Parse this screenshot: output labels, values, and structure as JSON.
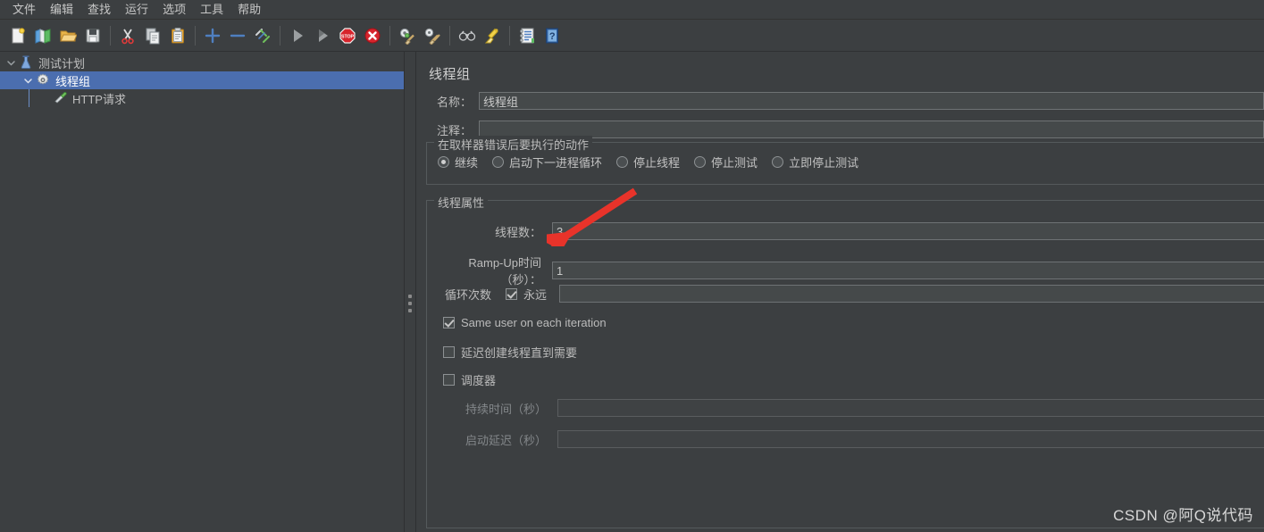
{
  "menubar": {
    "items": [
      {
        "label": "文件",
        "name": "menu-file"
      },
      {
        "label": "编辑",
        "name": "menu-edit"
      },
      {
        "label": "查找",
        "name": "menu-search"
      },
      {
        "label": "运行",
        "name": "menu-run"
      },
      {
        "label": "选项",
        "name": "menu-options"
      },
      {
        "label": "工具",
        "name": "menu-tools"
      },
      {
        "label": "帮助",
        "name": "menu-help"
      }
    ]
  },
  "toolbar": {
    "buttons": [
      {
        "icon": "new-document-icon",
        "group": 1
      },
      {
        "icon": "open-templates-icon",
        "group": 1
      },
      {
        "icon": "open-folder-icon",
        "group": 1
      },
      {
        "icon": "save-floppy-icon",
        "group": 1
      },
      {
        "icon": "cut-scissors-icon",
        "group": 2
      },
      {
        "icon": "copy-icon",
        "group": 2
      },
      {
        "icon": "paste-clipboard-icon",
        "group": 2
      },
      {
        "icon": "expand-plus-icon",
        "group": 3
      },
      {
        "icon": "collapse-minus-icon",
        "group": 3
      },
      {
        "icon": "toggle-enable-icon",
        "group": 3
      },
      {
        "icon": "start-play-icon",
        "group": 4
      },
      {
        "icon": "start-no-pauses-icon",
        "group": 4
      },
      {
        "icon": "stop-icon",
        "group": 4
      },
      {
        "icon": "shutdown-icon",
        "group": 4
      },
      {
        "icon": "clear-icon",
        "group": 5
      },
      {
        "icon": "clear-all-icon",
        "group": 5
      },
      {
        "icon": "search-binoculars-icon",
        "group": 6
      },
      {
        "icon": "reset-search-broom-icon",
        "group": 6
      },
      {
        "icon": "function-helper-icon",
        "group": 7
      },
      {
        "icon": "help-icon",
        "group": 7
      }
    ]
  },
  "tree": {
    "nodes": [
      {
        "label": "测试计划",
        "icon": "test-plan-icon",
        "depth": 0,
        "expanded": true,
        "selected": false
      },
      {
        "label": "线程组",
        "icon": "thread-group-gear-icon",
        "depth": 1,
        "expanded": true,
        "selected": true
      },
      {
        "label": "HTTP请求",
        "icon": "http-request-icon",
        "depth": 2,
        "expanded": false,
        "selected": false
      }
    ]
  },
  "config": {
    "panel_title": "线程组",
    "name_label": "名称：",
    "name_value": "线程组",
    "comment_label": "注释：",
    "comment_value": "",
    "error_action": {
      "group_title": "在取样器错误后要执行的动作",
      "options": [
        {
          "label": "继续",
          "selected": true
        },
        {
          "label": "启动下一进程循环",
          "selected": false
        },
        {
          "label": "停止线程",
          "selected": false
        },
        {
          "label": "停止测试",
          "selected": false
        },
        {
          "label": "立即停止测试",
          "selected": false
        }
      ]
    },
    "thread_properties": {
      "group_title": "线程属性",
      "thread_count_label": "线程数：",
      "thread_count_value": "3",
      "ramp_up_label": "Ramp-Up时间（秒）：",
      "ramp_up_value": "1",
      "loop_count_label": "循环次数",
      "forever_label": "永远",
      "forever_checked": true,
      "loop_count_value": "",
      "same_user_label": "Same user on each iteration",
      "same_user_checked": true,
      "delay_create_label": "延迟创建线程直到需要",
      "delay_create_checked": false,
      "scheduler_label": "调度器",
      "scheduler_checked": false,
      "duration_label": "持续时间（秒）",
      "duration_value": "",
      "duration_disabled": true,
      "startup_delay_label": "启动延迟（秒）",
      "startup_delay_value": "",
      "startup_delay_disabled": true
    }
  },
  "annotation": {
    "arrow_color": "#e8332a",
    "arrow_target": "thread-count-field"
  },
  "watermark": {
    "text": "CSDN @阿Q说代码"
  },
  "colors": {
    "background": "#3c3f41",
    "selection": "#4b6eaf",
    "field_bg": "#45494a",
    "border": "#6e7274",
    "text": "#bdbdbd",
    "accent_red": "#e8332a"
  }
}
